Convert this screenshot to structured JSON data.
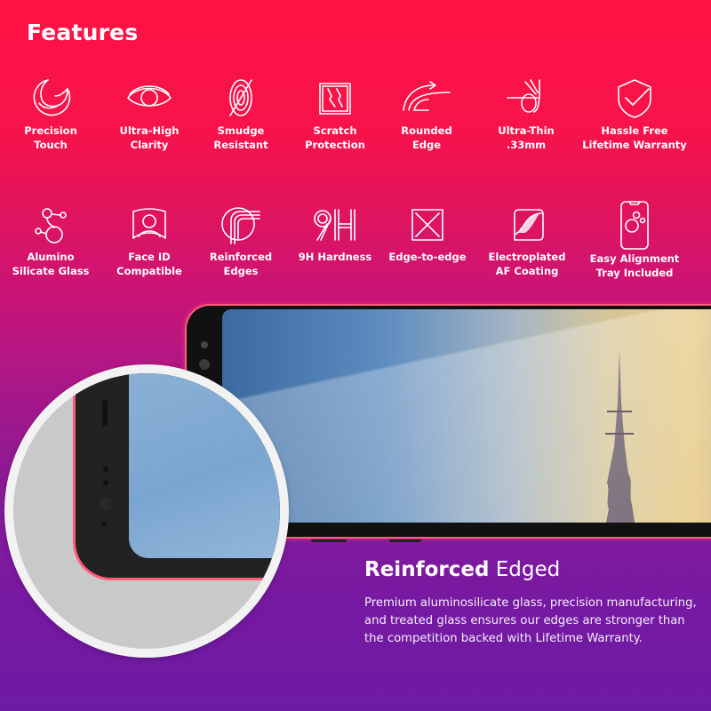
{
  "title": "Features",
  "colors": {
    "top": "#ff1244",
    "bottom": "#6e1ba3",
    "accent": "#ff5a78"
  },
  "features_row1": [
    {
      "icon": "precision-touch-icon",
      "label_line1": "Precision",
      "label_line2": "Touch"
    },
    {
      "icon": "eye-icon",
      "label_line1": "Ultra-High",
      "label_line2": "Clarity"
    },
    {
      "icon": "fingerprint-slash-icon",
      "label_line1": "Smudge",
      "label_line2": "Resistant"
    },
    {
      "icon": "scratch-icon",
      "label_line1": "Scratch",
      "label_line2": "Protection"
    },
    {
      "icon": "rounded-edge-icon",
      "label_line1": "Rounded",
      "label_line2": "Edge"
    },
    {
      "icon": "ultra-thin-icon",
      "label_line1": "Ultra-Thin",
      "label_line2": ".33mm"
    },
    {
      "icon": "shield-check-icon",
      "label_line1": "Hassle Free",
      "label_line2": "Lifetime Warranty"
    }
  ],
  "features_row2": [
    {
      "icon": "molecule-icon",
      "label_line1": "Alumino",
      "label_line2": "Silicate Glass"
    },
    {
      "icon": "face-id-icon",
      "label_line1": "Face ID",
      "label_line2": "Compatible"
    },
    {
      "icon": "reinforced-edge-icon",
      "label_line1": "Reinforced",
      "label_line2": "Edges"
    },
    {
      "icon": "9h-icon",
      "label_line1": "9H Hardness",
      "label_line2": ""
    },
    {
      "icon": "edge-to-edge-icon",
      "label_line1": "Edge-to-edge",
      "label_line2": ""
    },
    {
      "icon": "af-coating-icon",
      "label_line1": "Electroplated",
      "label_line2": "AF Coating"
    },
    {
      "icon": "alignment-tray-icon",
      "label_line1": "Easy Alignment",
      "label_line2": "Tray Included"
    }
  ],
  "section": {
    "heading_bold": "Reinforced",
    "heading_light": "Edged",
    "body": "Premium aluminosilicate glass, precision manufacturing, and treated glass ensures our edges are stronger than the competition backed with Lifetime Warranty."
  }
}
